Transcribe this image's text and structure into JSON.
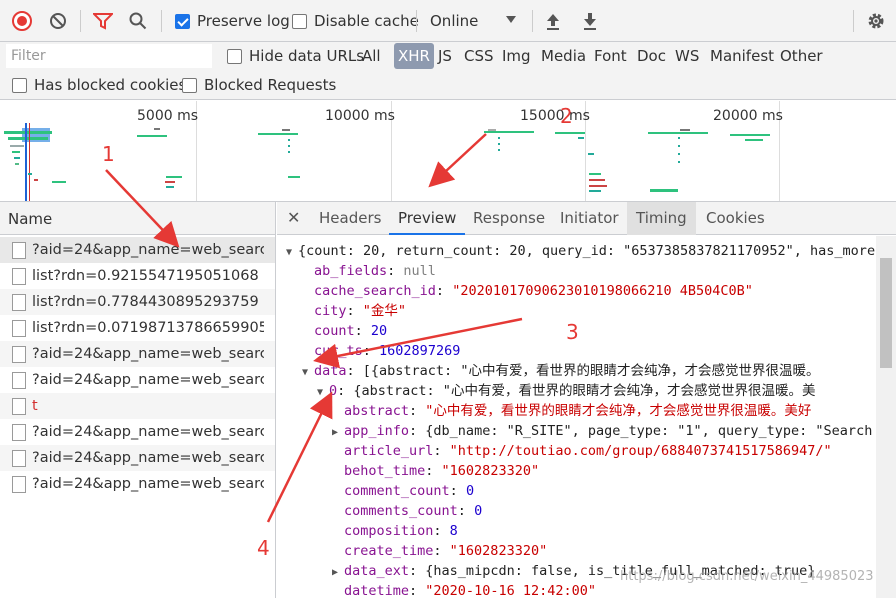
{
  "toolbar": {
    "preserve_log": "Preserve log",
    "disable_cache": "Disable cache",
    "throttle": "Online"
  },
  "filter": {
    "placeholder": "Filter",
    "hide_data_urls": "Hide data URLs",
    "types": [
      "All",
      "XHR",
      "JS",
      "CSS",
      "Img",
      "Media",
      "Font",
      "Doc",
      "WS",
      "Manifest",
      "Other"
    ],
    "selected": "XHR",
    "has_blocked_cookies": "Has blocked cookies",
    "blocked_requests": "Blocked Requests"
  },
  "overview": {
    "ticks": [
      "5000 ms",
      "10000 ms",
      "15000 ms",
      "20000 ms"
    ]
  },
  "names": {
    "header": "Name",
    "rows": [
      "?aid=24&app_name=web_search...",
      "list?rdn=0.9215547195051068",
      "list?rdn=0.7784430895293759",
      "list?rdn=0.07198713786659905",
      "?aid=24&app_name=web_search...",
      "?aid=24&app_name=web_search...",
      "t",
      "?aid=24&app_name=web_search...",
      "?aid=24&app_name=web_search...",
      "?aid=24&app_name=web_search..."
    ]
  },
  "detail": {
    "tabs": [
      "Headers",
      "Preview",
      "Response",
      "Initiator",
      "Timing",
      "Cookies"
    ],
    "active_tab": "Preview"
  },
  "preview": {
    "l0": "{count: 20, return_count: 20, query_id: \"6537385837821170952\", has_more",
    "ab_fields_k": "ab_fields",
    "ab_fields_v": "null",
    "cache_k": "cache_search_id",
    "cache_v": "\"20201017090623010198066210 4B504C0B\"",
    "city_k": "city",
    "city_v": "\"金华\"",
    "count_k": "count",
    "count_v": "20",
    "cur_k": "cur_ts",
    "cur_v": "1602897269",
    "data_k": "data",
    "data_v": "[{abstract: \"心中有爱，看世界的眼睛才会纯净，才会感觉世界很温暖。",
    "item0_k": "0",
    "item0_v": "{abstract: \"心中有爱，看世界的眼睛才会纯净，才会感觉世界很温暖。美",
    "abstract_k": "abstract",
    "abstract_v": "\"心中有爱，看世界的眼睛才会纯净，才会感觉世界很温暖。美好",
    "app_info_k": "app_info",
    "app_info_v": "{db_name: \"R_SITE\", page_type: \"1\", query_type: \"Search",
    "article_url_k": "article_url",
    "article_url_v": "\"http://toutiao.com/group/6884073741517586947/\"",
    "behot_k": "behot_time",
    "behot_v": "\"1602823320\"",
    "comment_count_k": "comment_count",
    "comment_count_v": "0",
    "comments_count_k": "comments_count",
    "comments_count_v": "0",
    "composition_k": "composition",
    "composition_v": "8",
    "create_k": "create_time",
    "create_v": "\"1602823320\"",
    "data_ext_k": "data_ext",
    "data_ext_v": "{has_mipcdn: false, is_title_full_matched: true}",
    "datetime_k": "datetime",
    "datetime_v": "\"2020-10-16 12:42:00\""
  },
  "annotations": [
    "1",
    "2",
    "3",
    "4"
  ],
  "watermark": "https://blog.csdn.net/weixin_44985023",
  "colors": {
    "accent": "#1a73e8",
    "record": "#e53935",
    "arrow": "#e53935"
  }
}
